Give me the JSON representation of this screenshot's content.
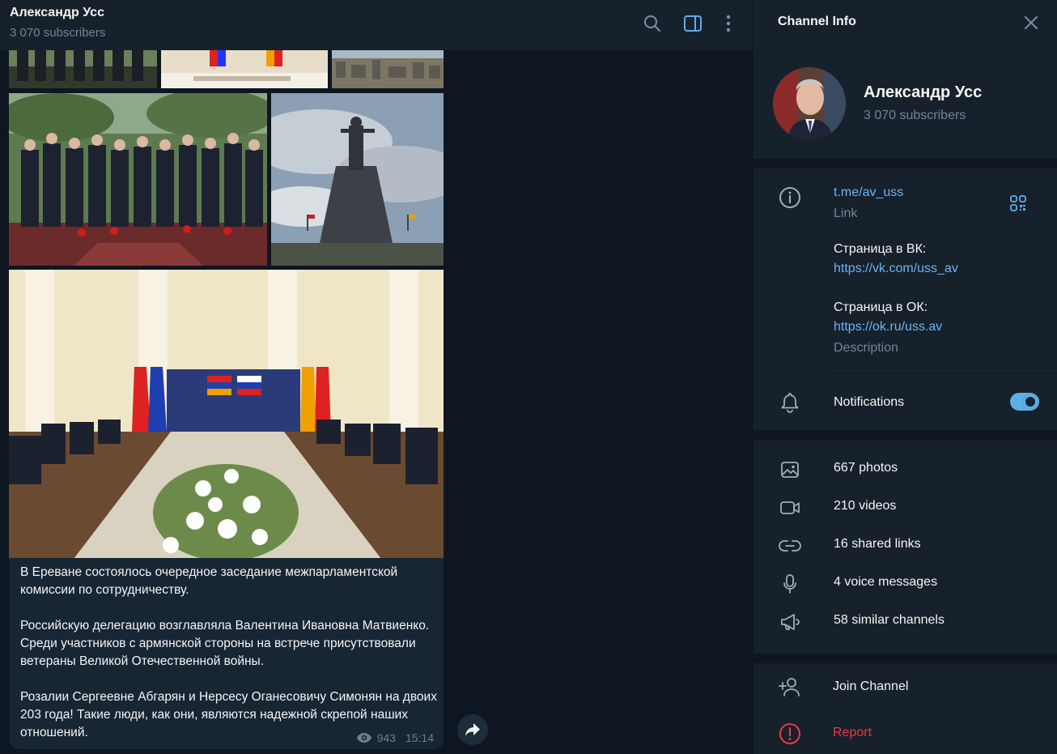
{
  "chat": {
    "title": "Александр Усс",
    "subtitle": "3 070 subscribers",
    "message": {
      "paragraphs": [
        "В Ереване состоялось очередное заседание межпарламентской комиссии по сотрудничеству.",
        "Российскую делегацию возглавляла Валентина Ивановна Матвиенко. Среди участников с армянской стороны на встрече присутствовали ветераны Великой Отечественной войны.",
        "Розалии Сергеевне Абгарян и Нерсесу Оганесовичу Симонян на двоих 203 года! Такие люди, как они, являются надежной скрепой наших отношений."
      ],
      "views": "943",
      "time": "15:14"
    }
  },
  "panel": {
    "title": "Channel Info",
    "name": "Александр Усс",
    "subscribers": "3 070 subscribers",
    "link": "t.me/av_uss",
    "link_caption": "Link",
    "vk_label": "Страница в ВК:",
    "vk_url": "https://vk.com/uss_av",
    "ok_label": "Страница в ОК:",
    "ok_url": "https://ok.ru/uss.av",
    "description_caption": "Description",
    "notifications_label": "Notifications",
    "notifications_on": true,
    "media": [
      {
        "label": "667 photos",
        "icon": "photo-icon"
      },
      {
        "label": "210 videos",
        "icon": "video-icon"
      },
      {
        "label": "16 shared links",
        "icon": "link-icon"
      },
      {
        "label": "4 voice messages",
        "icon": "microphone-icon"
      },
      {
        "label": "58 similar channels",
        "icon": "megaphone-icon"
      }
    ],
    "join_label": "Join Channel",
    "report_label": "Report"
  },
  "colors": {
    "accent": "#5eaee8",
    "link": "#6ab3f3",
    "danger": "#ec3942",
    "background": "#0e1621",
    "panel": "#17212b",
    "bubble": "#182533",
    "muted": "#708499"
  }
}
